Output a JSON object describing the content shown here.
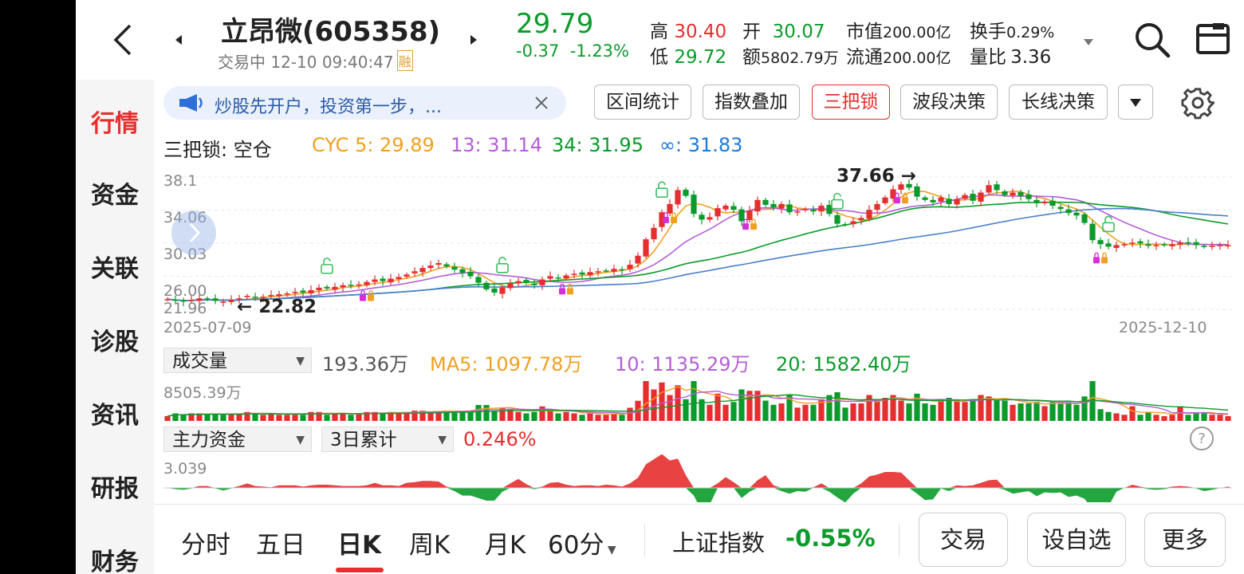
{
  "header": {
    "stock_name": "立昂微(605358)",
    "trade_status": "交易中 12-10 09:40:47",
    "rong_badge": "融",
    "price": "29.79",
    "change": "-0.37",
    "change_pct": "-1.23%",
    "high_label": "高",
    "high_value": "30.40",
    "low_label": "低",
    "low_value": "29.72",
    "open_label": "开",
    "open_value": "30.07",
    "amount_label": "额",
    "amount_value": "5802.79万",
    "mktcap_label": "市值",
    "mktcap_value": "200.00亿",
    "float_label": "流通",
    "float_value": "200.00亿",
    "turnover_label": "换手",
    "turnover_value": "0.29%",
    "volratio_label": "量比",
    "volratio_value": "3.36"
  },
  "sidebar": {
    "items": [
      {
        "label": "行情",
        "active": true
      },
      {
        "label": "资金"
      },
      {
        "label": "关联"
      },
      {
        "label": "诊股"
      },
      {
        "label": "资讯"
      },
      {
        "label": "研报"
      },
      {
        "label": "财务"
      }
    ]
  },
  "promo": {
    "text": "炒股先开户，投资第一步，..."
  },
  "tabs": [
    "区间统计",
    "指数叠加",
    "三把锁",
    "波段决策",
    "长线决策"
  ],
  "active_tab": "三把锁",
  "indicator": {
    "name": "三把锁: 空仓",
    "cyc5": "CYC 5: 29.89",
    "cyc13": "13: 31.14",
    "cyc34": "34: 31.95",
    "cycinf": "∞: 31.83"
  },
  "kline": {
    "y_labels": [
      "38.1",
      "34.06",
      "30.03",
      "26.00",
      "21.96"
    ],
    "date_start": "2025-07-09",
    "date_end": "2025-12-10",
    "high_mark": "37.66",
    "low_mark": "22.82"
  },
  "volume": {
    "selector": "成交量",
    "current": "193.36万",
    "ma5": "MA5: 1097.78万",
    "ma10": "10: 1135.29万",
    "ma20": "20: 1582.40万",
    "max_label": "8505.39万"
  },
  "fund": {
    "selector": "主力资金",
    "period": "3日累计",
    "value": "0.246%",
    "max_label": "3.039"
  },
  "bottom_tabs": [
    "分时",
    "五日",
    "日K",
    "周K",
    "月K",
    "60分"
  ],
  "active_bottom_tab": "日K",
  "index": {
    "name": "上证指数",
    "change": "-0.55%"
  },
  "actions": [
    "交易",
    "设自选",
    "更多"
  ],
  "colors": {
    "up": "#e62e2e",
    "down": "#0b9b2a",
    "accent": "#e62e2e"
  },
  "chart_data": {
    "type": "candlestick",
    "x_start": "2025-07-09",
    "x_end": "2025-12-10",
    "ylim": [
      21.96,
      38.1
    ],
    "closes": [
      23.2,
      23.0,
      22.9,
      23.1,
      23.3,
      23.2,
      23.0,
      22.9,
      23.1,
      23.3,
      23.6,
      23.4,
      23.5,
      23.7,
      23.8,
      23.9,
      24.1,
      24.0,
      24.3,
      24.6,
      24.5,
      24.7,
      24.9,
      24.8,
      25.0,
      25.3,
      25.6,
      25.4,
      25.7,
      25.9,
      26.2,
      26.6,
      27.0,
      27.3,
      27.6,
      27.2,
      26.8,
      26.4,
      26.0,
      25.2,
      24.4,
      24.0,
      24.6,
      25.1,
      25.4,
      25.2,
      24.9,
      25.6,
      26.0,
      25.8,
      26.1,
      26.3,
      26.2,
      26.5,
      26.6,
      26.7,
      26.9,
      26.8,
      27.4,
      28.5,
      30.5,
      31.9,
      33.8,
      34.8,
      36.5,
      35.8,
      33.6,
      32.9,
      33.2,
      34.3,
      34.6,
      34.1,
      32.7,
      34.0,
      35.3,
      34.7,
      34.4,
      34.8,
      33.8,
      33.9,
      34.2,
      33.9,
      34.6,
      33.6,
      32.4,
      32.3,
      32.7,
      33.1,
      34.1,
      34.8,
      35.6,
      36.6,
      37.2,
      36.8,
      35.7,
      35.3,
      35.0,
      35.6,
      34.8,
      35.4,
      35.9,
      35.2,
      36.2,
      37.1,
      36.5,
      35.9,
      36.2,
      35.8,
      35.4,
      34.9,
      35.1,
      34.6,
      34.2,
      33.7,
      33.4,
      32.5,
      30.4,
      29.9,
      29.6,
      29.8,
      29.9,
      30.1,
      30.0,
      29.7,
      29.8,
      29.8,
      29.9,
      30.1,
      30.0,
      29.8,
      29.6,
      29.7,
      29.8,
      29.8
    ]
  }
}
